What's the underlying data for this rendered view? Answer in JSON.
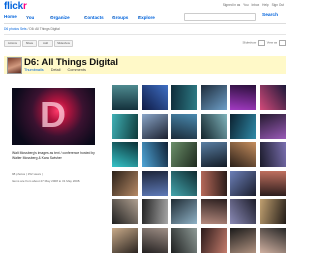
{
  "header": {
    "logo_part1": "flick",
    "logo_part2": "r",
    "top_links": [
      "Signed in as",
      "You",
      "Inbox",
      "Help",
      "Sign Out"
    ]
  },
  "nav": {
    "items": [
      "Home",
      "You",
      "Organize",
      "Contacts",
      "Groups",
      "Explore"
    ],
    "search_label": "Search"
  },
  "breadcrumb": {
    "items": [
      "D6 photos",
      "Sets"
    ],
    "suffix": "/ D6: All Things Digital"
  },
  "toolbar": {
    "pills": [
      "Actions",
      "Share",
      "Add",
      "Slideshow"
    ],
    "right_label": "Slideshow",
    "view_label": "View as"
  },
  "set": {
    "title": "D6: All Things Digital",
    "tabs": [
      "Thumbnails",
      "Detail",
      "Comments"
    ],
    "active_tab": 0
  },
  "main_photo": {
    "caption": "Walt Mossberg's images as text / conference hosted by Walter Mossberg & Kara Swisher",
    "meta_text": "98 photos | 152 views |",
    "meta_link": "",
    "date_text": "Items are from about 27 May 2008 to 31 May 2008."
  },
  "thumbnails": [
    {
      "c1": "#14313c",
      "c2": "#4e8a8f"
    },
    {
      "c1": "#0e1a45",
      "c2": "#3f6fc4"
    },
    {
      "c1": "#0f2c3a",
      "c2": "#2d7b85"
    },
    {
      "c1": "#1d2b3a",
      "c2": "#6e9fc8"
    },
    {
      "c1": "#2a0f3a",
      "c2": "#a23ac2"
    },
    {
      "c1": "#1a1838",
      "c2": "#d44a7a"
    },
    {
      "c1": "#0f3a3a",
      "c2": "#3fb0b5"
    },
    {
      "c1": "#1b1f2e",
      "c2": "#8aa6c8"
    },
    {
      "c1": "#1a2a38",
      "c2": "#4a8ab0"
    },
    {
      "c1": "#12232a",
      "c2": "#7fb3bb"
    },
    {
      "c1": "#0c2230",
      "c2": "#2f8aa8"
    },
    {
      "c1": "#241a2e",
      "c2": "#9a5ab8"
    },
    {
      "c1": "#0b2e34",
      "c2": "#36c4c8"
    },
    {
      "c1": "#102035",
      "c2": "#4fa6d8"
    },
    {
      "c1": "#1e2a1e",
      "c2": "#6b8f6a"
    },
    {
      "c1": "#121a24",
      "c2": "#5a7fa3"
    },
    {
      "c1": "#2a1f18",
      "c2": "#c68e5e"
    },
    {
      "c1": "#1a1a2a",
      "c2": "#7a6fb0"
    },
    {
      "c1": "#2a2018",
      "c2": "#b68a66"
    },
    {
      "c1": "#1c2438",
      "c2": "#5f7bb8"
    },
    {
      "c1": "#0f2a2f",
      "c2": "#44a5ad"
    },
    {
      "c1": "#2a1c1a",
      "c2": "#b86a5a"
    },
    {
      "c1": "#1a1d2c",
      "c2": "#6c80b8"
    },
    {
      "c1": "#2b1c1c",
      "c2": "#c0705f"
    },
    {
      "c1": "#1f1f1f",
      "c2": "#b0a090"
    },
    {
      "c1": "#232323",
      "c2": "#a6a6a6"
    },
    {
      "c1": "#1e2a33",
      "c2": "#8fb2c6"
    },
    {
      "c1": "#2a1e1e",
      "c2": "#b58a7e"
    },
    {
      "c1": "#1d1d2a",
      "c2": "#8a8ab6"
    },
    {
      "c1": "#221c18",
      "c2": "#c0a070"
    },
    {
      "c1": "#2a2420",
      "c2": "#c9ab8a"
    },
    {
      "c1": "#232020",
      "c2": "#9f8f86"
    },
    {
      "c1": "#1e2020",
      "c2": "#8e9a96"
    },
    {
      "c1": "#2a1a1a",
      "c2": "#c47c6c"
    },
    {
      "c1": "#1a1a1a",
      "c2": "#b09280"
    },
    {
      "c1": "#262626",
      "c2": "#d0b0a0"
    }
  ]
}
